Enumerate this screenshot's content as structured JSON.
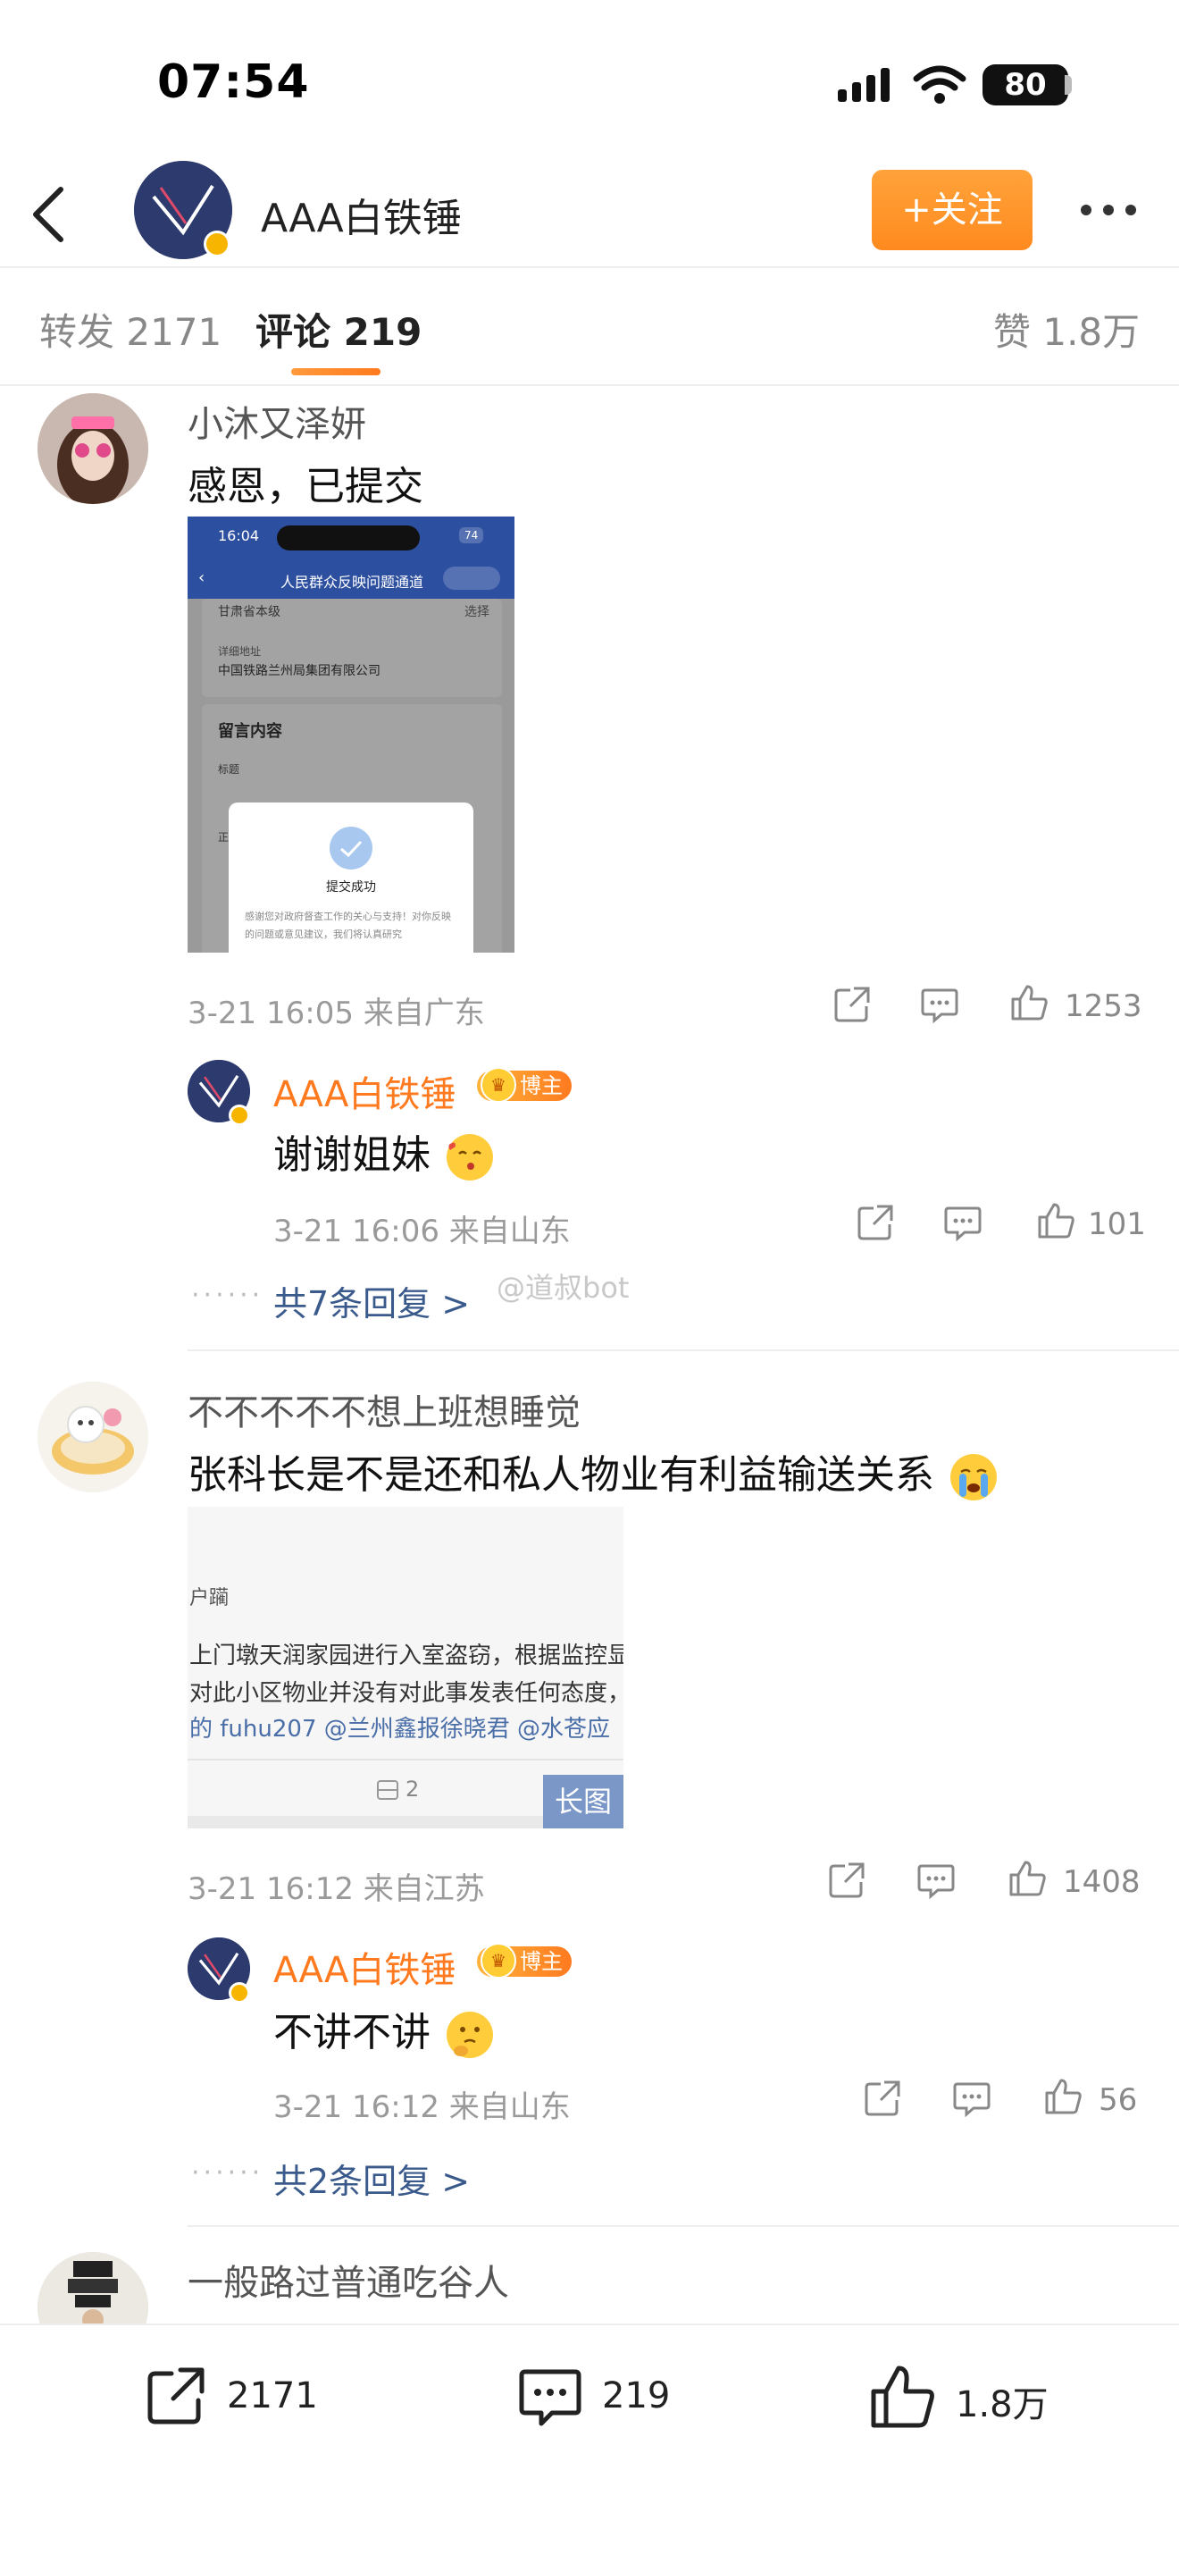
{
  "status_bar": {
    "time": "07:54",
    "battery": "80"
  },
  "header": {
    "name": "AAA白铁锤",
    "follow_label": "+关注"
  },
  "tabs": [
    {
      "label": "转发 2171"
    },
    {
      "label": "评论 219"
    },
    {
      "label": "赞 1.8万"
    }
  ],
  "comments": [
    {
      "user": "小沐又泽妍",
      "text": "感恩，已提交",
      "image": {
        "time": "16:04",
        "battery": "74",
        "title": "人民群众反映问题通道",
        "row1": "甘肃省本级",
        "row1_action": "选择",
        "addr_label": "详细地址",
        "addr_value": "中国铁路兰州局集团有限公司",
        "section": "留言内容",
        "field_title": "标题",
        "field_body": "正",
        "dialog_title": "提交成功",
        "dialog_text": "感谢您对政府督查工作的关心与支持！对你反映的问题或意见建议，我们将认真研究"
      },
      "meta": "3-21 16:05 来自广东",
      "likes": "1253",
      "reply": {
        "user": "AAA白铁锤",
        "badge": "博主",
        "text": "谢谢姐妹",
        "meta": "3-21 16:06 来自山东",
        "likes": "101"
      },
      "more_replies": "共7条回复 >"
    },
    {
      "user": "不不不不不想上班想睡觉",
      "text": "张科长是不是还和私人物业有利益输送关系",
      "image": {
        "line0": "户躏",
        "line1": "上门墩天润家园进行入室盗窃，根据监控显",
        "line2": "对此小区物业并没有对此事发表任何态度，",
        "line3": "的 fuhu207 @兰州鑫报徐晓君 @水苍应",
        "count": "2",
        "long_label": "长图"
      },
      "meta": "3-21 16:12 来自江苏",
      "likes": "1408",
      "reply": {
        "user": "AAA白铁锤",
        "badge": "博主",
        "text": "不讲不讲",
        "meta": "3-21 16:12 来自山东",
        "likes": "56"
      },
      "more_replies": "共2条回复 >"
    },
    {
      "user": "一般路过普通吃谷人"
    }
  ],
  "watermark": "@道叔bot",
  "bottom_bar": {
    "reposts": "2171",
    "comments": "219",
    "likes": "1.8万"
  },
  "colors": {
    "accent": "#ff8a1f",
    "link": "#3a5a8c",
    "verified": "#f7b500"
  }
}
